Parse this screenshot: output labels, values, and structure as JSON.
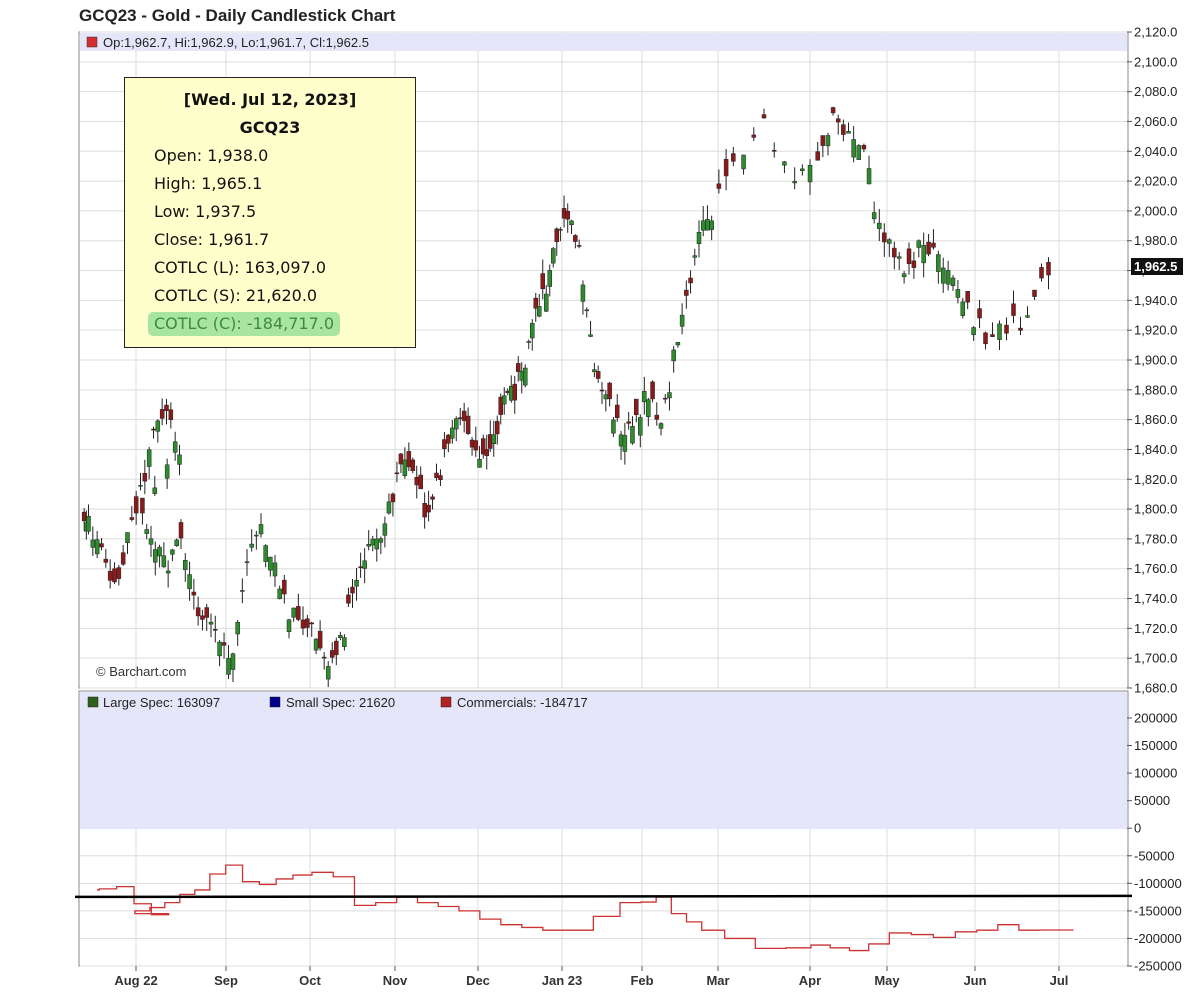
{
  "header": {
    "title": "GCQ23 - Gold - Daily Candlestick Chart",
    "ohlc_text": "Op:1,962.7, Hi:1,962.9, Lo:1,961.7, Cl:1,962.5",
    "watermark": "© Barchart.com",
    "last_price_badge": "1,962.5"
  },
  "tooltip": {
    "date": "[Wed. Jul 12, 2023]",
    "symbol": "GCQ23",
    "open": "Open: 1,938.0",
    "high": "High: 1,965.1",
    "low": "Low: 1,937.5",
    "close": "Close: 1,961.7",
    "cotlc_l": "COTLC (L): 163,097.0",
    "cotlc_s": "COTLC (S): 21,620.0",
    "cotlc_c": "COTLC (C): -184,717.0"
  },
  "legend": {
    "large_spec": "Large Spec: 163097",
    "small_spec": "Small Spec: 21620",
    "commercials": "Commercials: -184717"
  },
  "colors": {
    "up": "#2e8b2e",
    "down": "#8b1a1a",
    "commercials": "#cc3333",
    "large_spec": "#2f5f1f",
    "small_spec": "#00008b",
    "band": "#e6e6fa",
    "tooltip_bg": "#ffffcc",
    "highlight": "#a8e6a0"
  },
  "chart_data": [
    {
      "type": "candlestick",
      "title": "GCQ23 - Gold - Daily Candlestick Chart",
      "x_labels": [
        "Aug 22",
        "Sep",
        "Oct",
        "Nov",
        "Dec",
        "Jan 23",
        "Feb",
        "Mar",
        "Apr",
        "May",
        "Jun",
        "Jul"
      ],
      "ylim": [
        1680,
        2120
      ],
      "y_ticks": [
        "2,120.0",
        "2,100.0",
        "2,080.0",
        "2,060.0",
        "2,040.0",
        "2,020.0",
        "2,000.0",
        "1,980.0",
        "1,960.0",
        "1,940.0",
        "1,920.0",
        "1,900.0",
        "1,880.0",
        "1,860.0",
        "1,840.0",
        "1,820.0",
        "1,800.0",
        "1,780.0",
        "1,760.0",
        "1,740.0",
        "1,720.0",
        "1,700.0",
        "1,680.0"
      ],
      "grid": true,
      "close_path": [
        [
          "Aug 22",
          1790
        ],
        [
          "Aug 22",
          1770
        ],
        [
          "Aug 22",
          1745
        ],
        [
          "Aug 22",
          1780
        ],
        [
          "Aug 22",
          1810
        ],
        [
          "Aug 22",
          1850
        ],
        [
          "Aug 22",
          1865
        ],
        [
          "Aug 22",
          1840
        ],
        [
          "Sep",
          1800
        ],
        [
          "Sep",
          1775
        ],
        [
          "Sep",
          1760
        ],
        [
          "Sep",
          1780
        ],
        [
          "Sep",
          1740
        ],
        [
          "Sep",
          1725
        ],
        [
          "Sep",
          1715
        ],
        [
          "Oct",
          1700
        ],
        [
          "Oct",
          1770
        ],
        [
          "Oct",
          1785
        ],
        [
          "Oct",
          1760
        ],
        [
          "Oct",
          1730
        ],
        [
          "Oct",
          1725
        ],
        [
          "Nov",
          1715
        ],
        [
          "Nov",
          1700
        ],
        [
          "Nov",
          1710
        ],
        [
          "Nov",
          1740
        ],
        [
          "Nov",
          1765
        ],
        [
          "Nov",
          1780
        ],
        [
          "Nov",
          1800
        ],
        [
          "Dec",
          1830
        ],
        [
          "Dec",
          1820
        ],
        [
          "Dec",
          1800
        ],
        [
          "Dec",
          1815
        ],
        [
          "Dec",
          1850
        ],
        [
          "Dec",
          1865
        ],
        [
          "Dec",
          1840
        ],
        [
          "Jan 23",
          1830
        ],
        [
          "Jan 23",
          1850
        ],
        [
          "Jan 23",
          1870
        ],
        [
          "Jan 23",
          1880
        ],
        [
          "Jan 23",
          1900
        ],
        [
          "Jan 23",
          1930
        ],
        [
          "Jan 23",
          1950
        ],
        [
          "Jan 23",
          1980
        ],
        [
          "Feb",
          2000
        ],
        [
          "Feb",
          1970
        ],
        [
          "Feb",
          1910
        ],
        [
          "Feb",
          1880
        ],
        [
          "Feb",
          1865
        ],
        [
          "Feb",
          1850
        ],
        [
          "Feb",
          1860
        ],
        [
          "Mar",
          1880
        ],
        [
          "Mar",
          1855
        ],
        [
          "Mar",
          1900
        ],
        [
          "Mar",
          1940
        ],
        [
          "Mar",
          1980
        ],
        [
          "Mar",
          2000
        ],
        [
          "Apr",
          2030
        ],
        [
          "Apr",
          2060
        ],
        [
          "Apr",
          2020
        ],
        [
          "May",
          2040
        ],
        [
          "May",
          2060
        ],
        [
          "May",
          2050
        ],
        [
          "May",
          2040
        ],
        [
          "May",
          1985
        ],
        [
          "Jun",
          1970
        ],
        [
          "Jun",
          1960
        ],
        [
          "Jun",
          1980
        ],
        [
          "Jun",
          1965
        ],
        [
          "Jun",
          1955
        ],
        [
          "Jun",
          1935
        ],
        [
          "Jul",
          1915
        ],
        [
          "Jul",
          1920
        ],
        [
          "Jul",
          1930
        ],
        [
          "Jul",
          1962.5
        ]
      ],
      "last": {
        "open": 1962.7,
        "high": 1962.9,
        "low": 1961.7,
        "close": 1962.5
      }
    },
    {
      "type": "line",
      "title": "",
      "ylim": [
        -250000,
        200000
      ],
      "y_ticks": [
        "200000",
        "150000",
        "100000",
        "50000",
        "0",
        "-50000",
        "-100000",
        "-150000",
        "-200000",
        "-250000"
      ],
      "series": [
        {
          "name": "Large Spec",
          "values": [
            163097
          ]
        },
        {
          "name": "Small Spec",
          "values": [
            21620
          ]
        },
        {
          "name": "Commercials",
          "points": [
            [
              "Aug 22",
              -112000
            ],
            [
              "Aug 22",
              -110000
            ],
            [
              "Aug 22",
              -106000
            ],
            [
              "Aug 22",
              -137000
            ],
            [
              "Aug 22",
              -157000
            ],
            [
              "Aug 22",
              -155000
            ],
            [
              "Sep",
              -150000
            ],
            [
              "Sep",
              -144000
            ],
            [
              "Sep",
              -135000
            ],
            [
              "Sep",
              -120000
            ],
            [
              "Sep",
              -112000
            ],
            [
              "Sep",
              -83000
            ],
            [
              "Oct",
              -67000
            ],
            [
              "Oct",
              -97000
            ],
            [
              "Oct",
              -102000
            ],
            [
              "Oct",
              -92000
            ],
            [
              "Oct",
              -85000
            ],
            [
              "Nov",
              -80000
            ],
            [
              "Nov",
              -88000
            ],
            [
              "Nov",
              -140000
            ],
            [
              "Nov",
              -135000
            ],
            [
              "Dec",
              -125000
            ],
            [
              "Dec",
              -135000
            ],
            [
              "Dec",
              -142000
            ],
            [
              "Dec",
              -150000
            ],
            [
              "Jan 23",
              -165000
            ],
            [
              "Jan 23",
              -175000
            ],
            [
              "Jan 23",
              -180000
            ],
            [
              "Jan 23",
              -185000
            ],
            [
              "Feb",
              -185000
            ],
            [
              "Feb",
              -160000
            ],
            [
              "Feb",
              -135000
            ],
            [
              "Mar",
              -134000
            ],
            [
              "Mar",
              -125000
            ],
            [
              "Mar",
              -155000
            ],
            [
              "Mar",
              -170000
            ],
            [
              "Mar",
              -185000
            ],
            [
              "Apr",
              -200000
            ],
            [
              "Apr",
              -218000
            ],
            [
              "Apr",
              -217000
            ],
            [
              "May",
              -212000
            ],
            [
              "May",
              -217000
            ],
            [
              "May",
              -222000
            ],
            [
              "May",
              -210000
            ],
            [
              "Jun",
              -190000
            ],
            [
              "Jun",
              -193000
            ],
            [
              "Jun",
              -198000
            ],
            [
              "Jun",
              -188000
            ],
            [
              "Jul",
              -185000
            ],
            [
              "Jul",
              -175000
            ],
            [
              "Jul",
              -185000
            ],
            [
              "Jul",
              -184717
            ]
          ]
        }
      ],
      "reference_line": -130000
    }
  ]
}
